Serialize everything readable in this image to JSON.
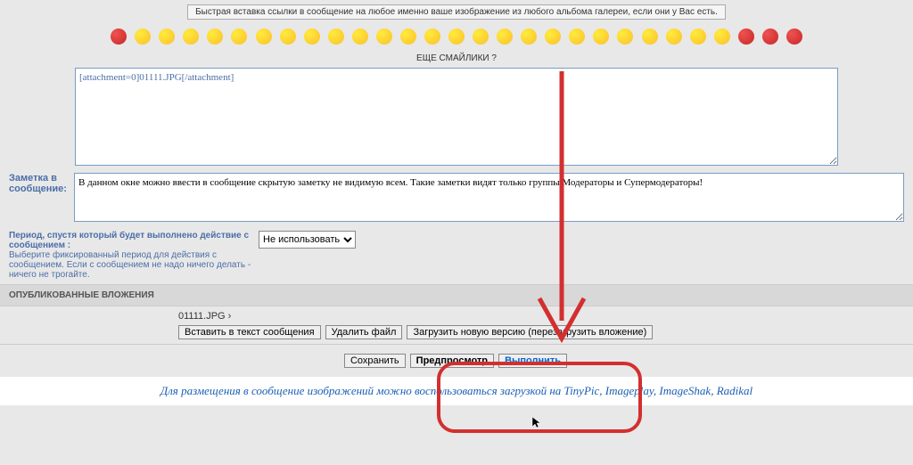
{
  "tip": "Быстрая вставка ссылки в сообщение на любое именно ваше изображение из любого альбома галереи, если они у Вас есть.",
  "more_emoji": "ЕЩЕ СМАЙЛИКИ ?",
  "main_text": "[attachment=0]01111.JPG[/attachment]",
  "note_label": "Заметка в сообщение:",
  "note_text": "В данном окне можно ввести в сообщение скрытую заметку не видимую всем. Такие заметки видят только группы Модераторы и Супермодераторы!",
  "period": {
    "title": "Период, спустя который будет выполнено действие с сообщением :",
    "desc": "Выберите фиксированный период для действия с сообщением. Если с сообщением не надо ничего делать - ничего не трогайте.",
    "selected": "Не использовать"
  },
  "attachments": {
    "header": "ОПУБЛИКОВАННЫЕ ВЛОЖЕНИЯ",
    "filename": "01111.JPG ›",
    "btn_insert": "Вставить в текст сообщения",
    "btn_delete": "Удалить файл",
    "btn_reupload": "Загрузить новую версию (перезагрузить вложение)"
  },
  "actions": {
    "save": "Сохранить",
    "preview": "Предпросмотр",
    "execute": "Выполнить"
  },
  "footer": "Для размещения в сообщение изображений можно воспользоваться загрузкой на TinyPic, Imageplay, ImageShak, Radikal"
}
